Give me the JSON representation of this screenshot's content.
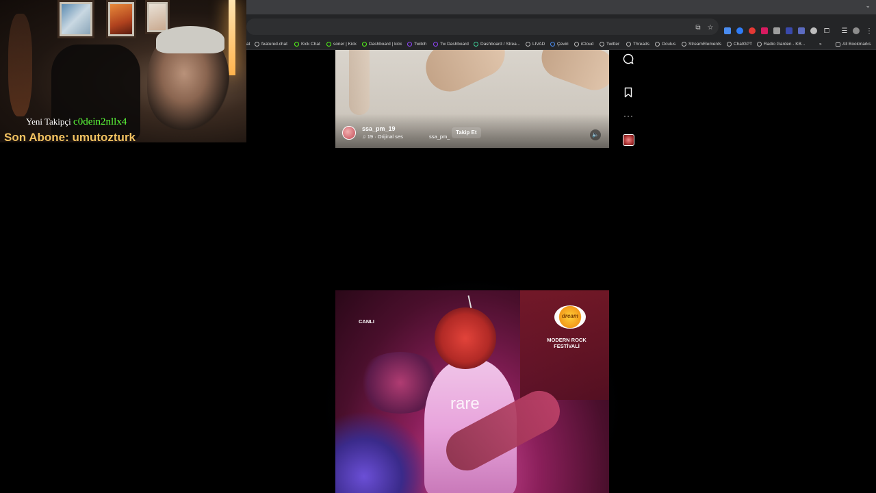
{
  "browser": {
    "bookmarks": [
      {
        "label": "featured.chat",
        "icon": "globe-icon"
      },
      {
        "label": "Kick Chat",
        "icon": "kick-icon"
      },
      {
        "label": "soner | Kick",
        "icon": "kick-icon"
      },
      {
        "label": "Dashboard | kick",
        "icon": "kick-icon"
      },
      {
        "label": "Twitch",
        "icon": "twitch-icon"
      },
      {
        "label": "Tw Dashboard",
        "icon": "twitch-icon"
      },
      {
        "label": "Dashboard / Strea...",
        "icon": "streamelements-icon"
      },
      {
        "label": "LIVAD",
        "icon": "globe-icon"
      },
      {
        "label": "Çeviri",
        "icon": "translate-icon"
      },
      {
        "label": "iCloud",
        "icon": "apple-icon"
      },
      {
        "label": "Twitter",
        "icon": "globe-icon"
      },
      {
        "label": "Threads",
        "icon": "globe-icon"
      },
      {
        "label": "Oculus",
        "icon": "globe-icon"
      },
      {
        "label": "StreamElements",
        "icon": "globe-icon"
      },
      {
        "label": "ChatGPT",
        "icon": "globe-icon"
      },
      {
        "label": "Radio Garden - KB...",
        "icon": "globe-icon"
      }
    ],
    "overflow_label": "»",
    "all_bookmarks_label": "All Bookmarks",
    "cut_bookmark_fragment": "at"
  },
  "overlay": {
    "follower_label": "Yeni Takipçi",
    "follower_name": "c0dein2nllx4",
    "subscriber_text": "Son Abone: umutozturk"
  },
  "reel1": {
    "username": "ssa_pm_19",
    "audio": "19 · Orijinal ses",
    "audio_user": "ssa_pm_",
    "follow_label": "Takip Et"
  },
  "reel2": {
    "live_label": "CANLI",
    "logo_text": "dream",
    "festival_line1": "MODERN ROCK",
    "festival_line2": "FESTİVALİ",
    "watermark": "rare"
  },
  "colors": {
    "follower_name": "#5dff3a",
    "subscriber": "#f2c261",
    "chrome_bg": "#242527"
  }
}
